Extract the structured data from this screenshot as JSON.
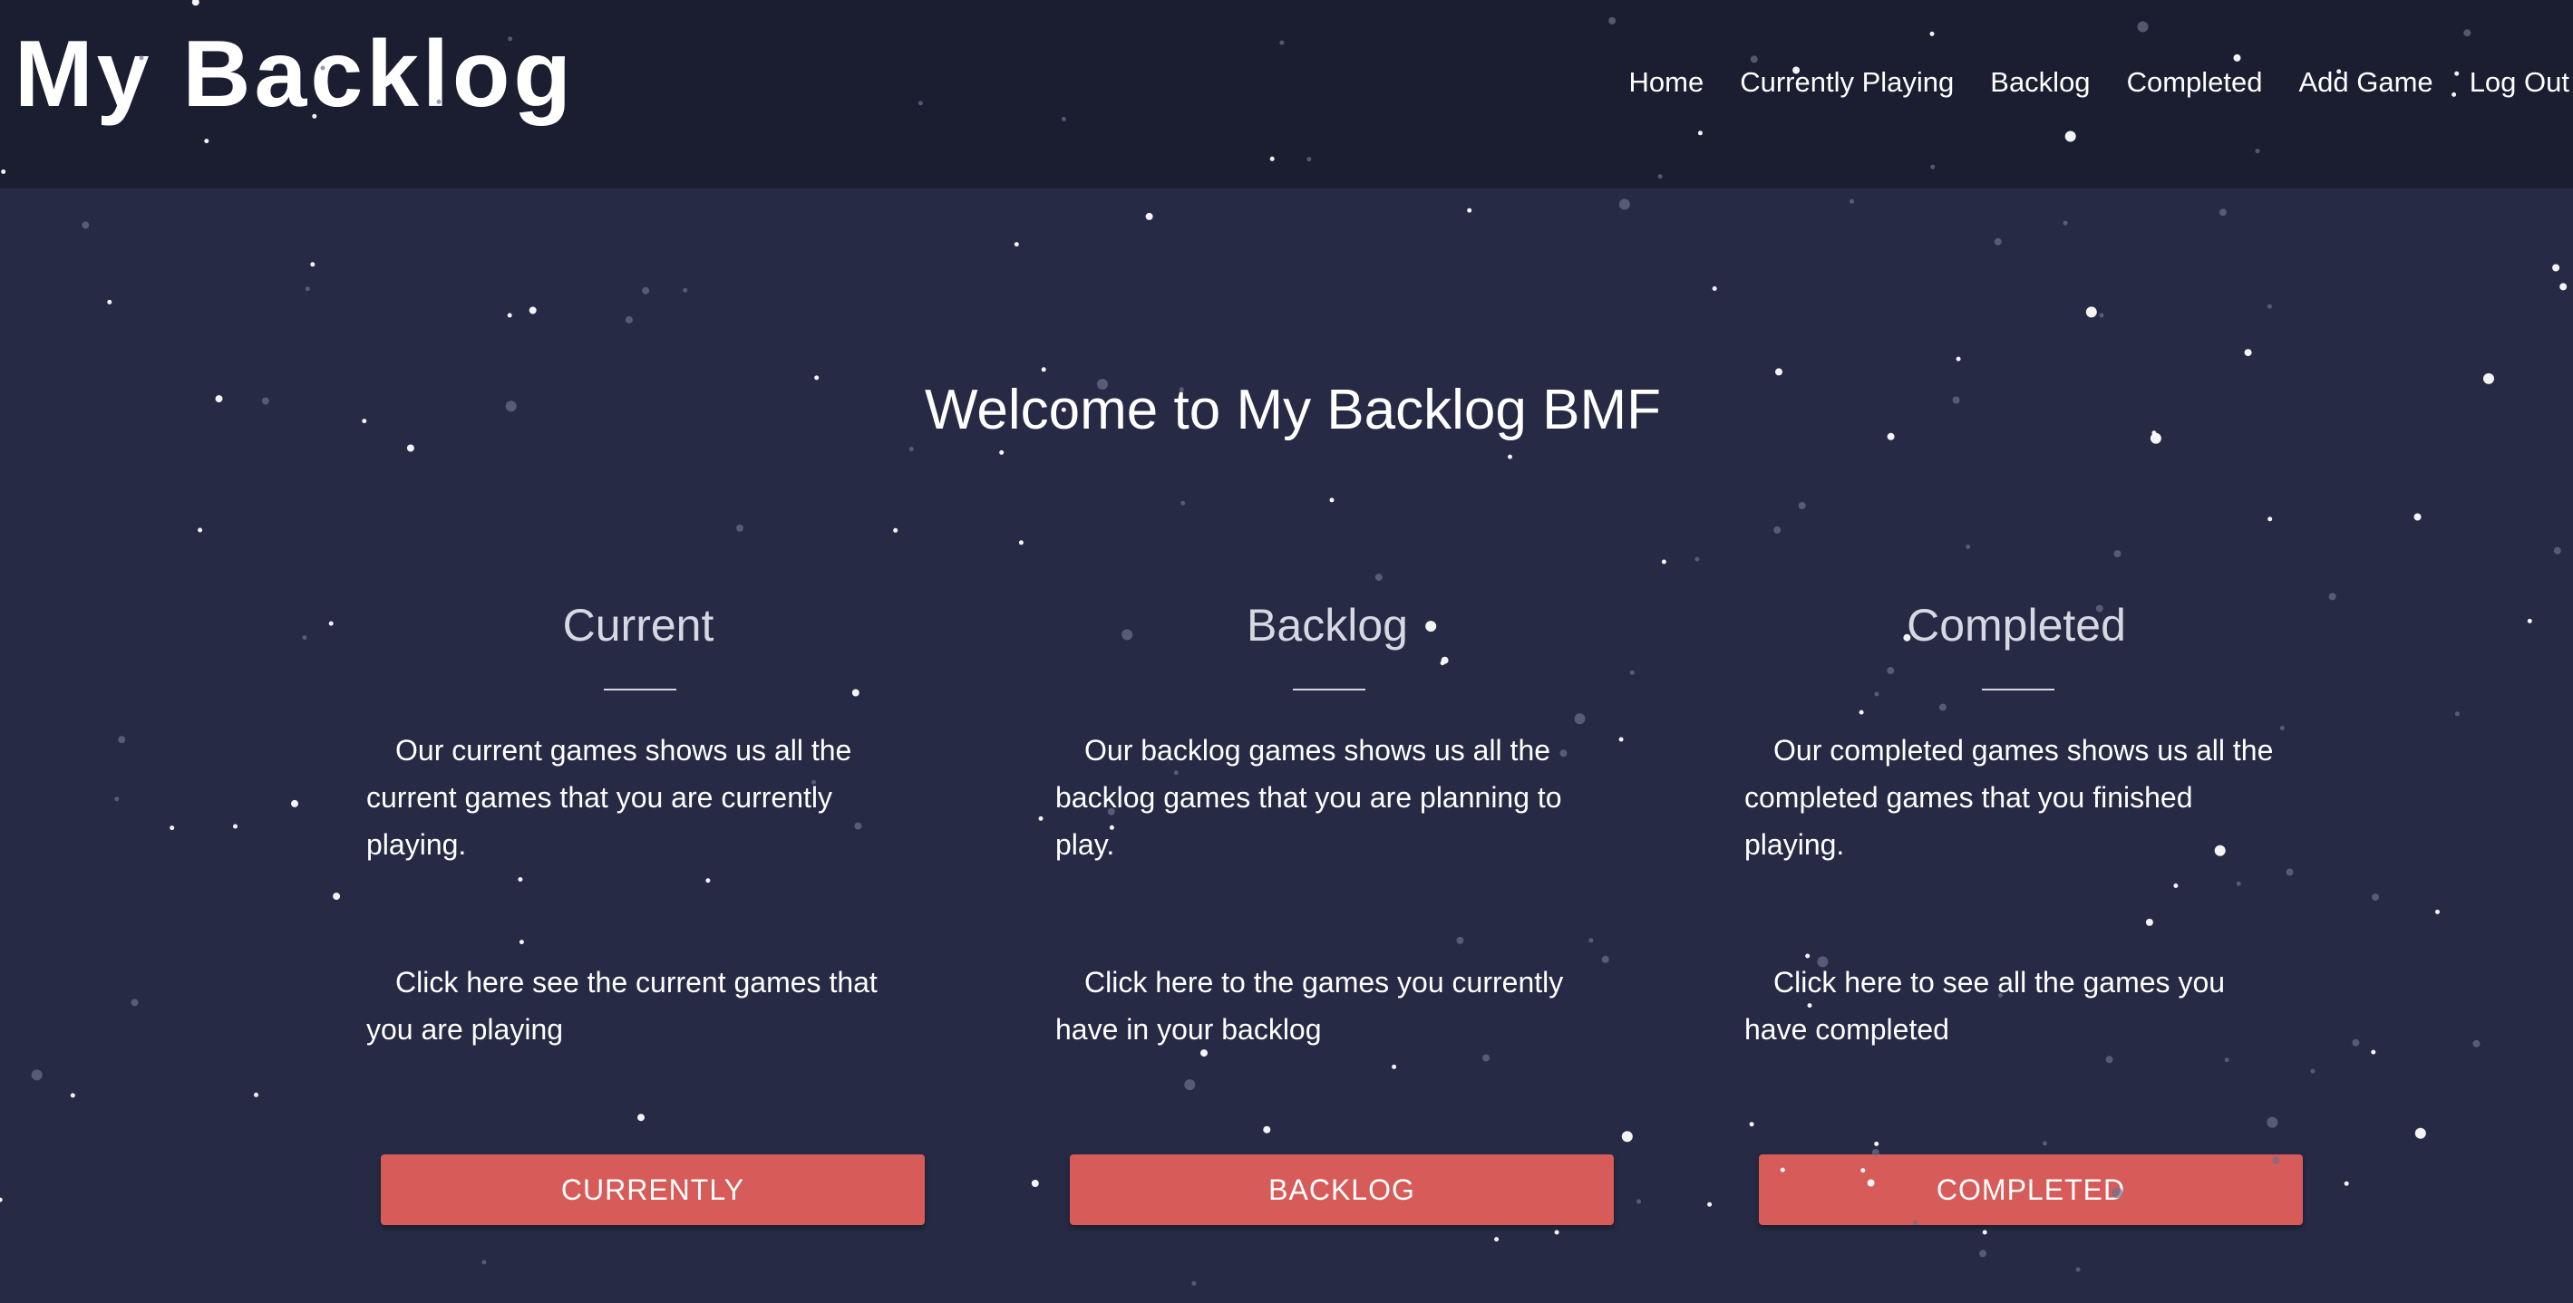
{
  "header": {
    "brand": "My Backlog",
    "nav": [
      "Home",
      "Currently Playing",
      "Backlog",
      "Completed",
      "Add Game",
      "Log Out"
    ]
  },
  "main": {
    "welcome": "Welcome to My Backlog BMF",
    "cards": [
      {
        "title": "Current",
        "description": "Our current games shows us all the current games that you are currently playing.",
        "link_text": "Click here see the current games that you are playing",
        "button": "CURRENTLY"
      },
      {
        "title": "Backlog",
        "description": "Our backlog games shows us all the backlog games that you are planning to play.",
        "link_text": "Click here to the games you currently have in your backlog",
        "button": "BACKLOG"
      },
      {
        "title": "Completed",
        "description": "Our completed games shows us all the completed games that you finished playing.",
        "link_text": "Click here to see all the games you have completed",
        "button": "COMPLETED"
      }
    ]
  },
  "colors": {
    "header_bg": "#1b1d30",
    "page_bg": "#262a44",
    "button": "#d75b58",
    "text": "#ffffff",
    "muted_text": "#d6d8e2"
  }
}
